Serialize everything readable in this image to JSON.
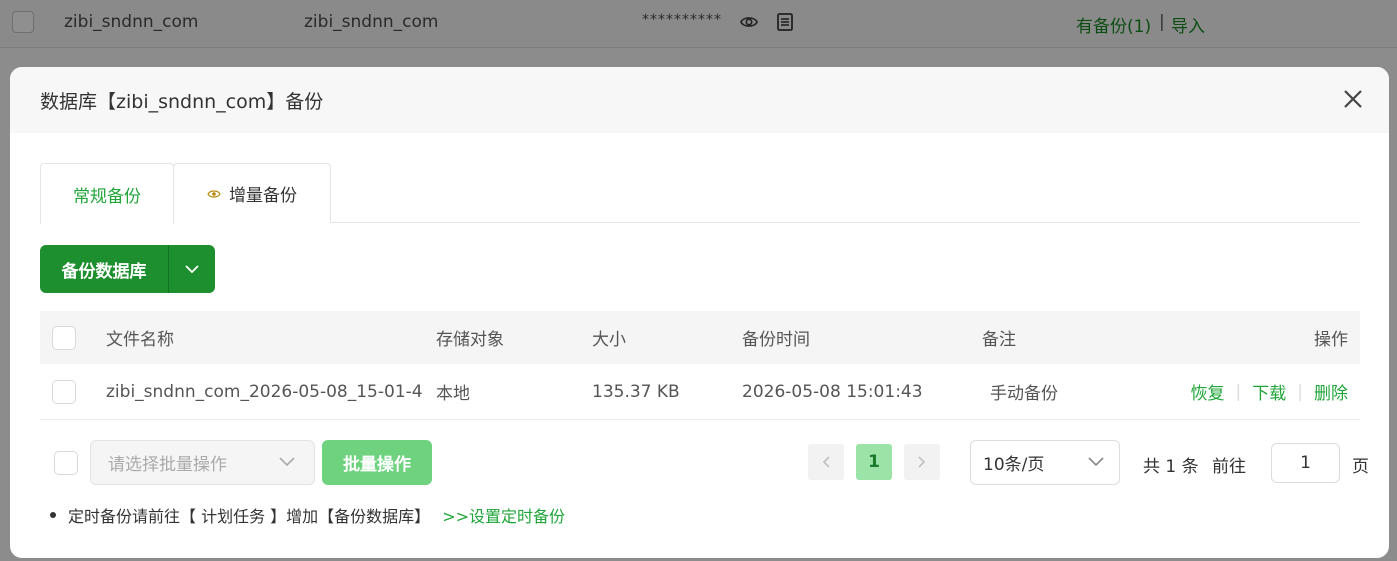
{
  "background_row": {
    "db_name": "zibi_sndnn_com",
    "username": "zibi_sndnn_com",
    "password_masked": "**********",
    "backup_status": "有备份(1)",
    "separator": "|",
    "import_label": "导入"
  },
  "dialog": {
    "title": "数据库【zibi_sndnn_com】备份",
    "tabs": [
      {
        "label": "常规备份",
        "active": true
      },
      {
        "label": "增量备份",
        "active": false
      }
    ],
    "backup_button": "备份数据库",
    "table": {
      "headers": {
        "name": "文件名称",
        "storage": "存储对象",
        "size": "大小",
        "time": "备份时间",
        "note": "备注",
        "ops": "操作"
      },
      "rows": [
        {
          "name": "zibi_sndnn_com_2026-05-08_15-01-4",
          "storage": "本地",
          "size": "135.37 KB",
          "time": "2026-05-08 15:01:43",
          "note": "手动备份",
          "ops": [
            "恢复",
            "下载",
            "删除"
          ]
        }
      ]
    },
    "footer": {
      "batch_placeholder": "请选择批量操作",
      "batch_button": "批量操作",
      "current_page": "1",
      "page_size": "10条/页",
      "total": "共 1 条",
      "goto_label": "前往",
      "goto_value": "1",
      "page_unit": "页"
    },
    "tip": {
      "text": "定时备份请前往【 计划任务 】增加【备份数据库】",
      "link": ">>设置定时备份"
    }
  },
  "colors": {
    "accent": "#20a53a",
    "button": "#1e8f2e",
    "overlay": "#8c8c8c"
  }
}
